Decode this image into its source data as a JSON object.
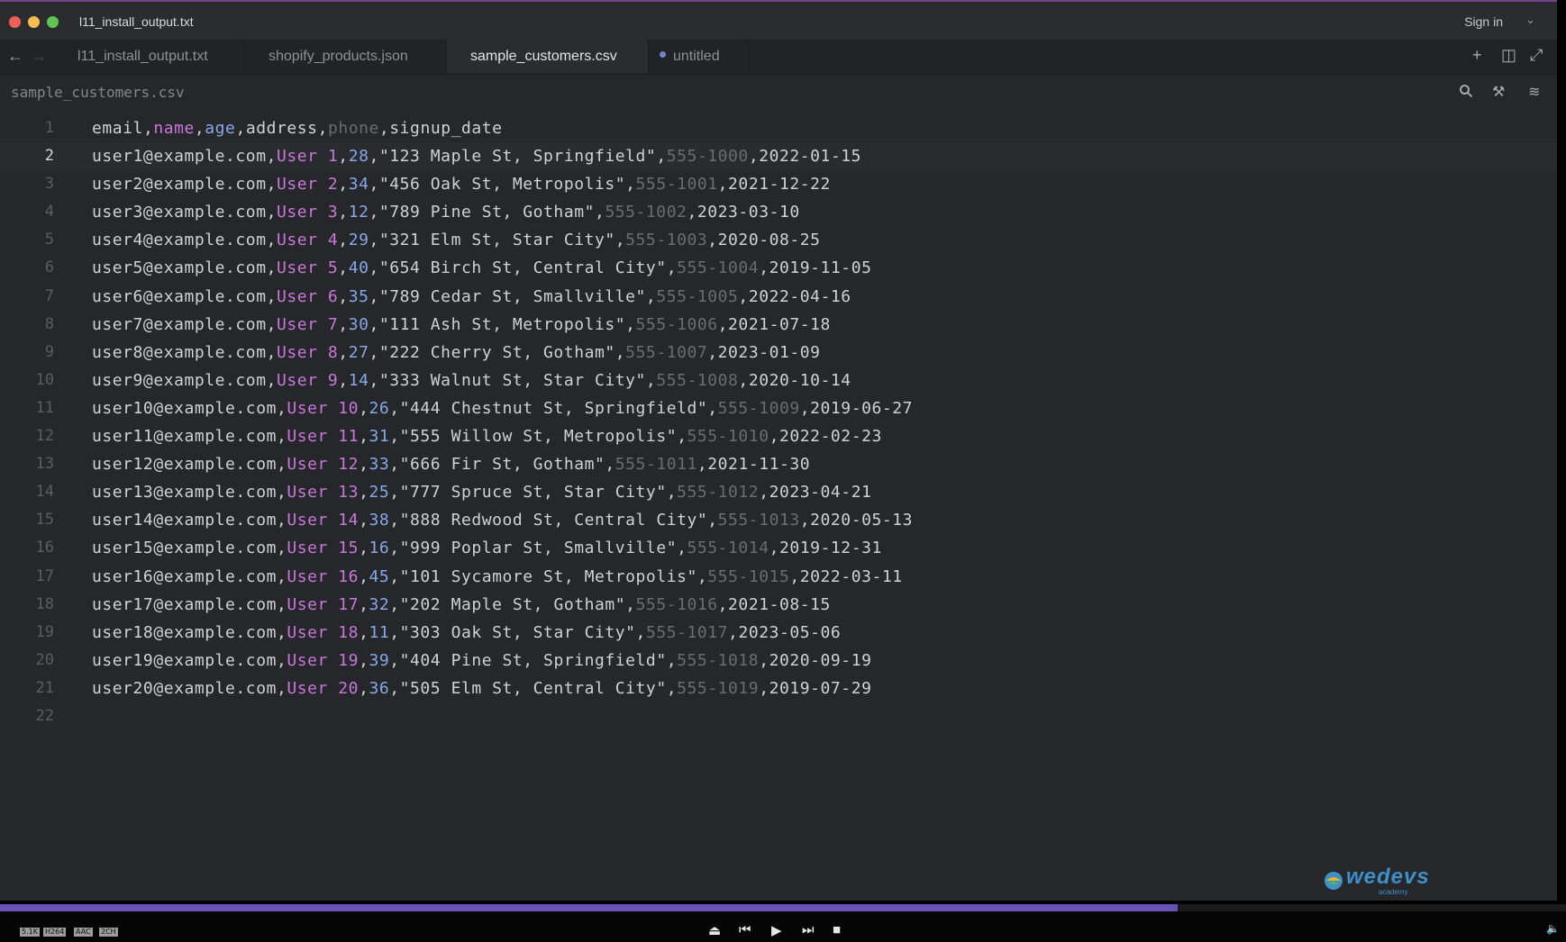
{
  "window": {
    "title": "l11_install_output.txt",
    "sign_in": "Sign in",
    "traffic_lights": [
      "#ee5f57",
      "#f5bd4f",
      "#5fc454"
    ]
  },
  "tabs": [
    {
      "label": "l11_install_output.txt",
      "active": false,
      "modified": false
    },
    {
      "label": "shopify_products.json",
      "active": false,
      "modified": false
    },
    {
      "label": "sample_customers.csv",
      "active": true,
      "modified": false
    },
    {
      "label": "untitled",
      "active": false,
      "modified": true
    }
  ],
  "path_bar": {
    "file": "sample_customers.csv"
  },
  "icons": {
    "back": "arrow-left-icon",
    "forward": "arrow-right-icon",
    "new_tab": "plus-icon",
    "split": "split-view-icon",
    "expand": "expand-icon",
    "search": "search-icon",
    "tools": "tools-icon",
    "settings": "sliders-icon"
  },
  "editor": {
    "current_line": 2,
    "lines": [
      {
        "n": "1",
        "f": [
          "email",
          "name",
          "age",
          "address",
          "phone",
          "signup_date"
        ]
      },
      {
        "n": "2",
        "f": [
          "user1@example.com",
          "User 1",
          "28",
          "\"123 Maple St, Springfield\"",
          "555-1000",
          "2022-01-15"
        ]
      },
      {
        "n": "3",
        "f": [
          "user2@example.com",
          "User 2",
          "34",
          "\"456 Oak St, Metropolis\"",
          "555-1001",
          "2021-12-22"
        ]
      },
      {
        "n": "4",
        "f": [
          "user3@example.com",
          "User 3",
          "12",
          "\"789 Pine St, Gotham\"",
          "555-1002",
          "2023-03-10"
        ]
      },
      {
        "n": "5",
        "f": [
          "user4@example.com",
          "User 4",
          "29",
          "\"321 Elm St, Star City\"",
          "555-1003",
          "2020-08-25"
        ]
      },
      {
        "n": "6",
        "f": [
          "user5@example.com",
          "User 5",
          "40",
          "\"654 Birch St, Central City\"",
          "555-1004",
          "2019-11-05"
        ]
      },
      {
        "n": "7",
        "f": [
          "user6@example.com",
          "User 6",
          "35",
          "\"789 Cedar St, Smallville\"",
          "555-1005",
          "2022-04-16"
        ]
      },
      {
        "n": "8",
        "f": [
          "user7@example.com",
          "User 7",
          "30",
          "\"111 Ash St, Metropolis\"",
          "555-1006",
          "2021-07-18"
        ]
      },
      {
        "n": "9",
        "f": [
          "user8@example.com",
          "User 8",
          "27",
          "\"222 Cherry St, Gotham\"",
          "555-1007",
          "2023-01-09"
        ]
      },
      {
        "n": "10",
        "f": [
          "user9@example.com",
          "User 9",
          "14",
          "\"333 Walnut St, Star City\"",
          "555-1008",
          "2020-10-14"
        ]
      },
      {
        "n": "11",
        "f": [
          "user10@example.com",
          "User 10",
          "26",
          "\"444 Chestnut St, Springfield\"",
          "555-1009",
          "2019-06-27"
        ]
      },
      {
        "n": "12",
        "f": [
          "user11@example.com",
          "User 11",
          "31",
          "\"555 Willow St, Metropolis\"",
          "555-1010",
          "2022-02-23"
        ]
      },
      {
        "n": "13",
        "f": [
          "user12@example.com",
          "User 12",
          "33",
          "\"666 Fir St, Gotham\"",
          "555-1011",
          "2021-11-30"
        ]
      },
      {
        "n": "14",
        "f": [
          "user13@example.com",
          "User 13",
          "25",
          "\"777 Spruce St, Star City\"",
          "555-1012",
          "2023-04-21"
        ]
      },
      {
        "n": "15",
        "f": [
          "user14@example.com",
          "User 14",
          "38",
          "\"888 Redwood St, Central City\"",
          "555-1013",
          "2020-05-13"
        ]
      },
      {
        "n": "16",
        "f": [
          "user15@example.com",
          "User 15",
          "16",
          "\"999 Poplar St, Smallville\"",
          "555-1014",
          "2019-12-31"
        ]
      },
      {
        "n": "17",
        "f": [
          "user16@example.com",
          "User 16",
          "45",
          "\"101 Sycamore St, Metropolis\"",
          "555-1015",
          "2022-03-11"
        ]
      },
      {
        "n": "18",
        "f": [
          "user17@example.com",
          "User 17",
          "32",
          "\"202 Maple St, Gotham\"",
          "555-1016",
          "2021-08-15"
        ]
      },
      {
        "n": "19",
        "f": [
          "user18@example.com",
          "User 18",
          "11",
          "\"303 Oak St, Star City\"",
          "555-1017",
          "2023-05-06"
        ]
      },
      {
        "n": "20",
        "f": [
          "user19@example.com",
          "User 19",
          "39",
          "\"404 Pine St, Springfield\"",
          "555-1018",
          "2020-09-19"
        ]
      },
      {
        "n": "21",
        "f": [
          "user20@example.com",
          "User 20",
          "36",
          "\"505 Elm St, Central City\"",
          "555-1019",
          "2019-07-29"
        ]
      },
      {
        "n": "22",
        "f": []
      }
    ]
  },
  "watermark": {
    "brand": "wedevs",
    "sub": "academy"
  },
  "player": {
    "progress": 0.752,
    "badges": [
      "5.1K",
      "H264",
      "AAC",
      "2CH"
    ]
  }
}
